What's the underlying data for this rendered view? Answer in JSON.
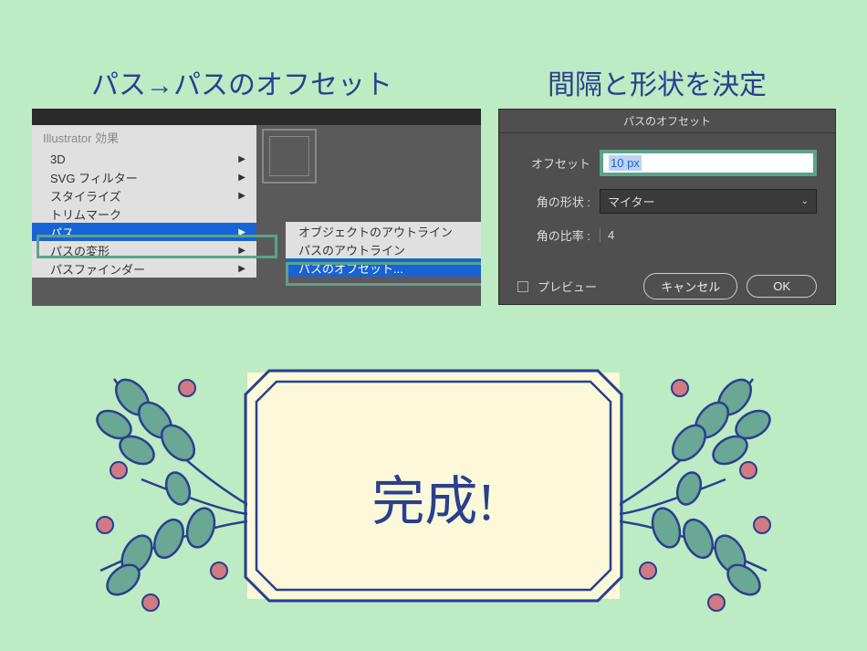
{
  "headings": {
    "left": "パス→パスのオフセット",
    "right": "間隔と形状を決定"
  },
  "menu": {
    "header": "Illustrator 効果",
    "items": [
      {
        "label": "3D",
        "arrow": true
      },
      {
        "label": "SVG フィルター",
        "arrow": true
      },
      {
        "label": "スタイライズ",
        "arrow": true
      },
      {
        "label": "トリムマーク",
        "arrow": false
      },
      {
        "label": "パス",
        "arrow": true,
        "highlight": true
      },
      {
        "label": "パスの変形",
        "arrow": true
      },
      {
        "label": "パスファインダー",
        "arrow": true
      }
    ],
    "submenu": [
      {
        "label": "オブジェクトのアウトライン"
      },
      {
        "label": "パスのアウトライン"
      },
      {
        "label": "パスのオフセット...",
        "highlight": true
      }
    ]
  },
  "dialog": {
    "title": "パスのオフセット",
    "offset_label": "オフセット",
    "offset_value": "10 px",
    "corner_label": "角の形状 :",
    "corner_value": "マイター",
    "ratio_label": "角の比率 :",
    "ratio_value": "4",
    "preview_label": "プレビュー",
    "cancel_label": "キャンセル",
    "ok_label": "OK"
  },
  "done": {
    "text": "完成!"
  },
  "colors": {
    "accent_blue": "#2a3f8f",
    "highlight_green": "#5aa48a",
    "menu_highlight": "#1763d6",
    "berry": "#d17a84",
    "leaf": "#6aa794"
  }
}
